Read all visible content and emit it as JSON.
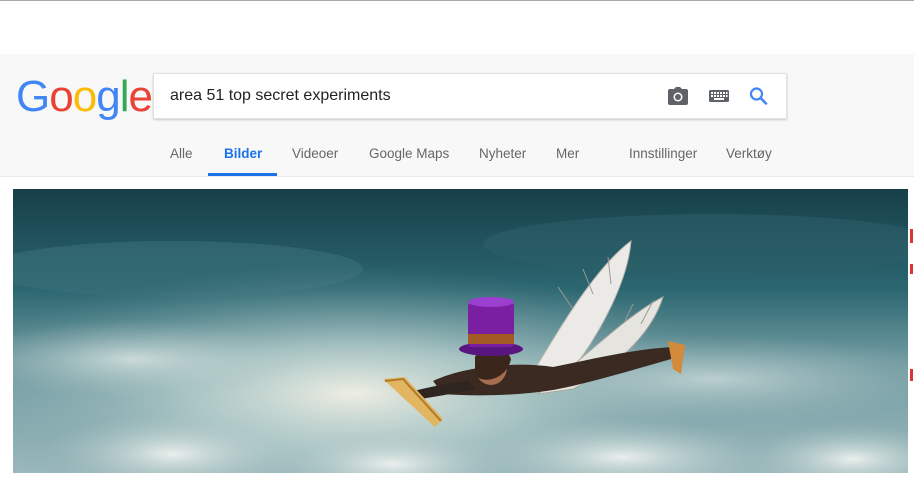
{
  "search": {
    "query": "area 51 top secret experiments"
  },
  "tabs": [
    {
      "label": "Alle"
    },
    {
      "label": "Bilder"
    },
    {
      "label": "Videoer"
    },
    {
      "label": "Google Maps"
    },
    {
      "label": "Nyheter"
    },
    {
      "label": "Mer"
    },
    {
      "label": "Innstillinger"
    },
    {
      "label": "Verktøy"
    }
  ],
  "active_tab": "Bilder",
  "icons": {
    "camera": "camera-icon",
    "keyboard": "keyboard-icon",
    "search": "search-icon"
  },
  "colors": {
    "accent": "#1a73e8",
    "logo_blue": "#4285f4",
    "logo_red": "#ea4335",
    "logo_yellow": "#fbbc05",
    "logo_green": "#34a853",
    "sky_dark": "#1f4f59",
    "hat_purple": "#7a1fa2"
  }
}
